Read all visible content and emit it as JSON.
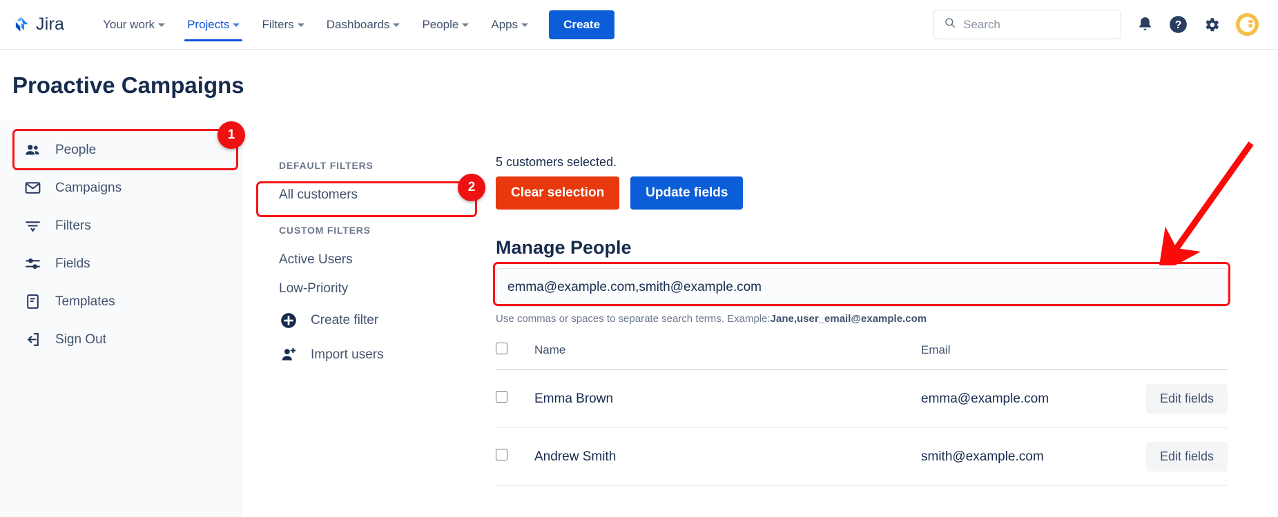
{
  "app": {
    "brand": "Jira",
    "logo_icon": "jira-logo-icon"
  },
  "topnav": {
    "items": [
      {
        "label": "Your work",
        "icon": "chevron-down-icon",
        "active": false
      },
      {
        "label": "Projects",
        "icon": "chevron-down-icon",
        "active": true
      },
      {
        "label": "Filters",
        "icon": "chevron-down-icon",
        "active": false
      },
      {
        "label": "Dashboards",
        "icon": "chevron-down-icon",
        "active": false
      },
      {
        "label": "People",
        "icon": "chevron-down-icon",
        "active": false
      },
      {
        "label": "Apps",
        "icon": "chevron-down-icon",
        "active": false
      }
    ],
    "create_label": "Create",
    "search": {
      "placeholder": "Search",
      "icon": "search-icon",
      "value": ""
    },
    "right_icons": [
      {
        "name": "notifications-bell-icon"
      },
      {
        "name": "help-question-icon"
      },
      {
        "name": "settings-gear-icon"
      },
      {
        "name": "user-avatar"
      }
    ],
    "accent_color": "#0b5ed7"
  },
  "page": {
    "title": "Proactive Campaigns"
  },
  "sidebar": {
    "items": [
      {
        "label": "People",
        "icon": "people-group-icon",
        "active": true
      },
      {
        "label": "Campaigns",
        "icon": "envelope-icon",
        "active": false
      },
      {
        "label": "Filters",
        "icon": "filter-funnel-icon",
        "active": false
      },
      {
        "label": "Fields",
        "icon": "sliders-icon",
        "active": false
      },
      {
        "label": "Templates",
        "icon": "document-icon",
        "active": false
      },
      {
        "label": "Sign Out",
        "icon": "sign-out-icon",
        "active": false
      }
    ]
  },
  "filters_panel": {
    "default_heading": "DEFAULT FILTERS",
    "default_items": [
      {
        "label": "All customers",
        "selected": true
      }
    ],
    "custom_heading": "CUSTOM FILTERS",
    "custom_items": [
      {
        "label": "Active Users"
      },
      {
        "label": "Low-Priority"
      }
    ],
    "actions": [
      {
        "label": "Create filter",
        "icon": "plus-circle-icon"
      },
      {
        "label": "Import users",
        "icon": "user-add-icon"
      }
    ]
  },
  "main": {
    "selection_text": "5 customers selected.",
    "clear_button": "Clear selection",
    "update_button": "Update fields",
    "clear_color": "#e8380d",
    "update_color": "#0b5ed7",
    "section_title": "Manage People",
    "search": {
      "value": "emma@example.com,smith@example.com",
      "placeholder": "",
      "hint_prefix": "Use commas or spaces to separate search terms. Example:",
      "hint_example": "Jane,user_email@example.com"
    },
    "table": {
      "columns": [
        "Name",
        "Email"
      ],
      "select_all_checked": false,
      "rows": [
        {
          "checked": false,
          "name": "Emma Brown",
          "email": "emma@example.com",
          "action": "Edit fields"
        },
        {
          "checked": false,
          "name": "Andrew Smith",
          "email": "smith@example.com",
          "action": "Edit fields"
        }
      ]
    }
  },
  "annotations": {
    "color": "#ed1111",
    "badges": [
      {
        "label": "1",
        "target": "sidebar-item-people"
      },
      {
        "label": "2",
        "target": "filter-all-customers"
      }
    ],
    "arrow": {
      "points_to": "manage-people-search-input"
    }
  }
}
